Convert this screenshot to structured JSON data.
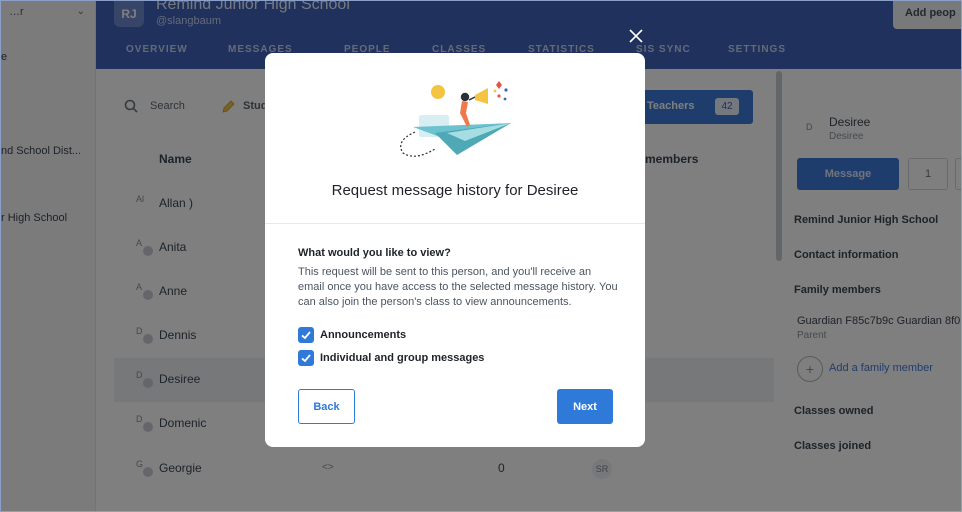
{
  "sidebar": {
    "dropdown_label": "…r",
    "items": [
      {
        "label": "e"
      },
      {
        "label": "nd School Dist..."
      },
      {
        "label": "r High School"
      }
    ]
  },
  "header": {
    "logo_text": "RJ",
    "school_name": "Remind Junior High School",
    "school_handle": "@slangbaum",
    "add_people_label": "Add peop",
    "nav": [
      "OVERVIEW",
      "MESSAGES",
      "PEOPLE",
      "CLASSES",
      "STATISTICS",
      "SIS SYNC",
      "SETTINGS"
    ]
  },
  "main": {
    "search_label": "Search",
    "students_label": "Stud",
    "teachers_tab": {
      "label": "Teachers",
      "count": "42"
    },
    "columns": {
      "name": "Name",
      "members": "members"
    },
    "rows": [
      {
        "initials": "Al",
        "name": "Allan )",
        "arrows": "",
        "count": "",
        "badge": ""
      },
      {
        "initials": "A",
        "name": "Anita",
        "arrows": "",
        "count": "",
        "badge": ""
      },
      {
        "initials": "A",
        "name": "Anne",
        "arrows": "",
        "count": "",
        "badge": ""
      },
      {
        "initials": "D",
        "name": "Dennis",
        "arrows": "",
        "count": "",
        "badge": ""
      },
      {
        "initials": "D",
        "name": "Desiree",
        "arrows": "",
        "count": "",
        "badge": ""
      },
      {
        "initials": "D",
        "name": "Domenic",
        "arrows": "",
        "count": "",
        "badge": ""
      },
      {
        "initials": "G",
        "name": "Georgie",
        "arrows": "<>",
        "count": "0",
        "badge": "SR"
      }
    ]
  },
  "right_panel": {
    "initials": "D",
    "name": "Desiree",
    "subname": "Desiree",
    "message_button": "Message",
    "second_button": "1",
    "school": "Remind Junior High School",
    "contact_heading": "Contact information",
    "family_heading": "Family members",
    "guardian": "Guardian F85c7b9c Guardian 8f0",
    "guardian_role": "Parent",
    "add_family": "Add a family member",
    "classes_owned": "Classes owned",
    "classes_joined": "Classes joined"
  },
  "modal": {
    "title": "Request message history for Desiree",
    "question": "What would you like to view?",
    "description": "This request will be sent to this person, and you'll receive an email once you have access to the selected message history. You can also join the person's class to view announcements.",
    "options": [
      {
        "label": "Announcements",
        "checked": true
      },
      {
        "label": "Individual and group messages",
        "checked": true
      }
    ],
    "back_label": "Back",
    "next_label": "Next"
  },
  "colors": {
    "header": "#3f62b8",
    "primary": "#2f7ad9",
    "overlay": "rgba(0,0,0,0.5)"
  },
  "icons": {
    "close": "close-icon",
    "search": "search-icon",
    "checkbox": "checkmark-icon",
    "illustration": "megaphone-paper-plane-illustration"
  }
}
